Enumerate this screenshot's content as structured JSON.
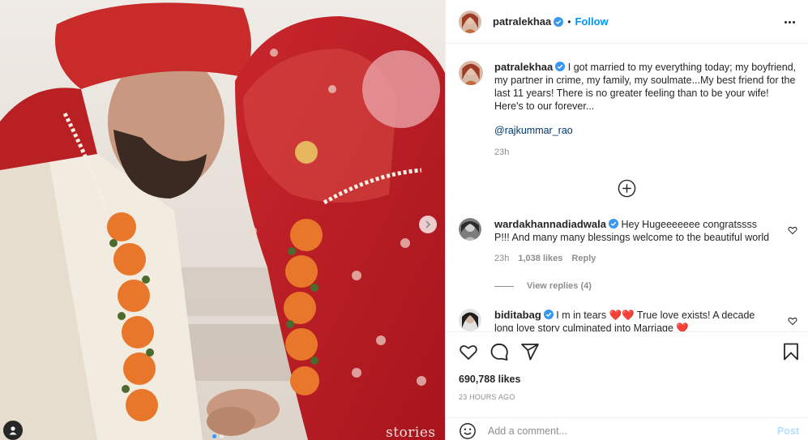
{
  "post": {
    "photo_watermark": "stories",
    "carousel": {
      "slides": 2,
      "current": 1
    }
  },
  "header": {
    "username": "patralekhaa",
    "separator": "•",
    "follow_label": "Follow"
  },
  "caption": {
    "username": "patralekhaa",
    "text": "I got married to my everything today; my boyfriend, my partner in crime, my family, my soulmate...My best friend for the last 11 years! There is no greater feeling than to be your wife! Here's to our forever...",
    "mention": "@rajkummar_rao",
    "time": "23h"
  },
  "comments": [
    {
      "username": "wardakhannadiadwala",
      "text": "Hey Hugeeeeeee congratssss P!!! And many many blessings welcome to the beautiful world",
      "time": "23h",
      "likes": "1,038 likes",
      "reply_label": "Reply",
      "view_replies": "View replies (4)"
    },
    {
      "username": "biditabag",
      "text": "I m in tears ❤️❤️ True love exists! A decade long love story culminated into Marriage ❤️"
    }
  ],
  "engagement": {
    "likes": "690,788 likes",
    "posted_ago": "23 HOURS AGO"
  },
  "composer": {
    "placeholder": "Add a comment...",
    "post_label": "Post"
  },
  "colors": {
    "accent": "#0095f6",
    "text": "#262626",
    "muted": "#8e8e8e",
    "post_disabled": "#b2dffc",
    "verified": "#3897f0"
  }
}
